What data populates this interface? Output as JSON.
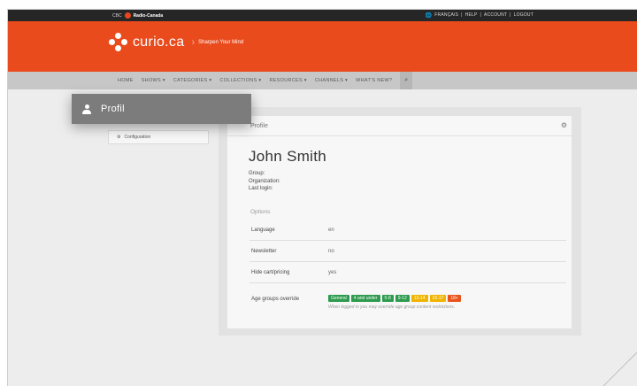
{
  "topbar": {
    "cbc": "CBC",
    "radio_canada": "Radio-Canada",
    "links": [
      "FRANÇAIS",
      "|",
      "HELP",
      "|",
      "ACCOUNT",
      "|",
      "LOGOUT"
    ]
  },
  "header": {
    "brand": "curio.ca",
    "tagline": "Sharpen Your Mind"
  },
  "nav": {
    "items": [
      "HOME",
      "SHOWS ▾",
      "CATEGORIES ▾",
      "COLLECTIONS ▾",
      "RESOURCES ▾",
      "CHANNELS ▾",
      "WHAT'S NEW?"
    ]
  },
  "sidemenu": {
    "item": "Configuration"
  },
  "profile": {
    "panel_title": "Profile",
    "name": "John Smith",
    "meta": [
      "Group:",
      "Organization:",
      "Last login:"
    ],
    "options_label": "Options",
    "rows": [
      {
        "label": "Language",
        "value": "en"
      },
      {
        "label": "Newsletter",
        "value": "no"
      },
      {
        "label": "Hide cart/pricing",
        "value": "yes"
      }
    ],
    "age_label": "Age groups override",
    "age_badges": [
      {
        "label": "General",
        "color": "#2e9b4e"
      },
      {
        "label": "4 and under",
        "color": "#2e9b4e"
      },
      {
        "label": "5-8",
        "color": "#2e9b4e"
      },
      {
        "label": "9-12",
        "color": "#2e9b4e"
      },
      {
        "label": "13-14",
        "color": "#f0b400"
      },
      {
        "label": "15-17",
        "color": "#f0b400"
      },
      {
        "label": "18+",
        "color": "#e8541c"
      }
    ],
    "age_hint": "When logged in you may override age group content restrictions."
  },
  "overlay": {
    "tab_label": "Profil",
    "tab_icon": "user-icon"
  },
  "colors": {
    "brand_orange": "#ea4b1c",
    "topbar": "#262626",
    "nav": "#c7c7c7",
    "overlay": "#7c7c7c"
  }
}
